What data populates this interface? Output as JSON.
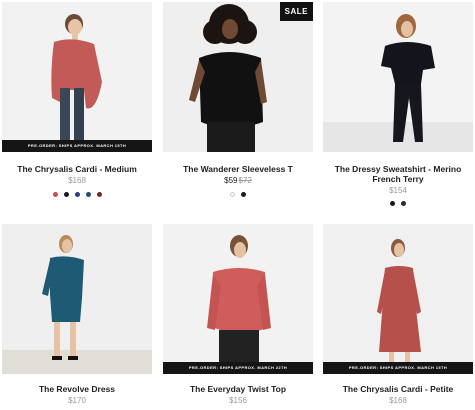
{
  "products": [
    {
      "title": "The Chrysalis Cardi - Medium",
      "price": "$168",
      "banner": "PRE-ORDER: SHIPS APPROX. MARCH 15TH",
      "swatches": [
        "#c2514f",
        "#1a1a1a",
        "#2b3a8a",
        "#1f4f6b",
        "#6b2a27"
      ]
    },
    {
      "title": "The Wanderer Sleeveless T",
      "price_now": "$59",
      "price_was": "$72",
      "sale_badge": "SALE",
      "swatches": [
        "#ffffff",
        "#1a1a1a"
      ]
    },
    {
      "title_line1": "The Dressy Sweatshirt - Merino",
      "title_line2": "French Terry",
      "price": "$154",
      "swatches": [
        "#1a1a1a",
        "#2b2b2b"
      ]
    },
    {
      "title": "The Revolve Dress",
      "price": "$170"
    },
    {
      "title": "The Everyday Twist Top",
      "price": "$156",
      "banner": "PRE-ORDER: SHIPS APPROX. MARCH 22TH"
    },
    {
      "title": "The Chrysalis Cardi - Petite",
      "price": "$168",
      "banner": "PRE-ORDER: SHIPS APPROX. MARCH 15TH"
    }
  ]
}
